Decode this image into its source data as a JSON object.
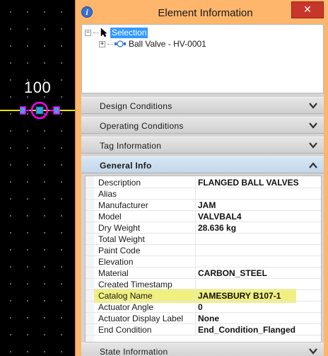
{
  "canvas": {
    "valve_number": "100"
  },
  "window": {
    "title": "Element Information",
    "close_label": "✕"
  },
  "tree": {
    "root_label": "Selection",
    "child_label": "Ball Valve - HV-0001"
  },
  "sections": [
    {
      "label": "Design Conditions"
    },
    {
      "label": "Operating Conditions"
    },
    {
      "label": "Tag Information"
    },
    {
      "label": "General Info"
    },
    {
      "label": "State Information"
    }
  ],
  "properties": [
    {
      "name": "Description",
      "value": "FLANGED BALL VALVES"
    },
    {
      "name": "Alias",
      "value": ""
    },
    {
      "name": "Manufacturer",
      "value": "JAM"
    },
    {
      "name": "Model",
      "value": "VALVBAL4"
    },
    {
      "name": "Dry Weight",
      "value": "28.636 kg"
    },
    {
      "name": "Total Weight",
      "value": ""
    },
    {
      "name": "Paint Code",
      "value": ""
    },
    {
      "name": "Elevation",
      "value": ""
    },
    {
      "name": "Material",
      "value": "CARBON_STEEL"
    },
    {
      "name": "Created Timestamp",
      "value": ""
    },
    {
      "name": "Catalog Name",
      "value": "JAMESBURY B107-1"
    },
    {
      "name": "Actuator Angle",
      "value": "0"
    },
    {
      "name": "Actuator Display Label",
      "value": "None"
    },
    {
      "name": "End Condition",
      "value": "End_Condition_Flanged"
    }
  ],
  "colors": {
    "window_frame": "#fdb66c",
    "close_button": "#c7362b",
    "selection_highlight": "#3399ff",
    "row_highlight": "#f0f080",
    "pipe": "#e6e600",
    "valve_symbol": "#ff00ff"
  }
}
